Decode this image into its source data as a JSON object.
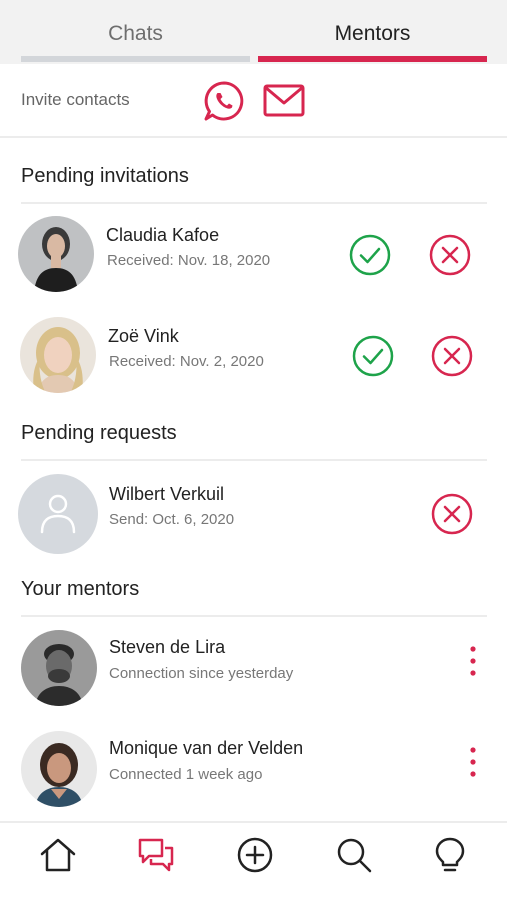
{
  "tabs": [
    {
      "label": "Chats",
      "active": false
    },
    {
      "label": "Mentors",
      "active": true
    }
  ],
  "invite": {
    "label": "Invite contacts",
    "channels": [
      "whatsapp-icon",
      "mail-icon"
    ]
  },
  "sections": {
    "pending_invitations": {
      "title": "Pending invitations",
      "items": [
        {
          "name": "Claudia Kafoe",
          "sub": "Received: Nov. 18, 2020"
        },
        {
          "name": "Zoë Vink",
          "sub": "Received: Nov. 2, 2020"
        }
      ]
    },
    "pending_requests": {
      "title": "Pending requests",
      "items": [
        {
          "name": "Wilbert Verkuil",
          "sub": "Send: Oct. 6, 2020"
        }
      ]
    },
    "your_mentors": {
      "title": "Your mentors",
      "items": [
        {
          "name": "Steven de Lira",
          "sub": "Connection since yesterday"
        },
        {
          "name": "Monique van der Velden",
          "sub": "Connected 1 week ago"
        }
      ]
    }
  },
  "bottom_nav": [
    "home-icon",
    "chats-icon",
    "add-icon",
    "search-icon",
    "lightbulb-icon"
  ],
  "colors": {
    "accent": "#d7264f",
    "accept": "#1ea34a",
    "tab_inactive_bar": "#d3d6da",
    "placeholder_avatar": "#d5d9de"
  }
}
